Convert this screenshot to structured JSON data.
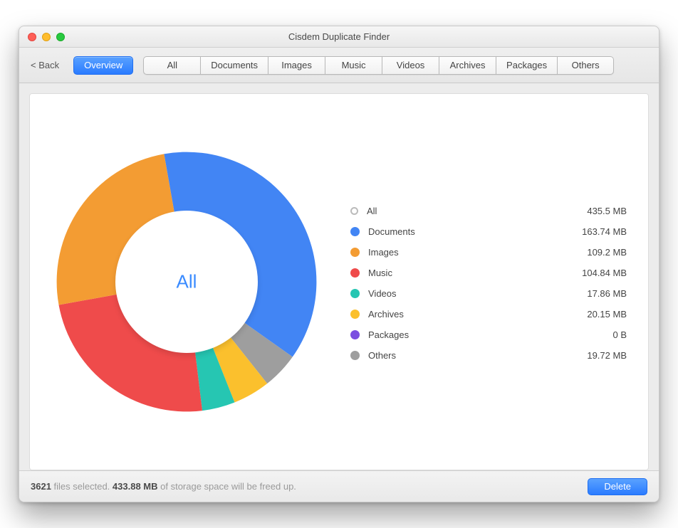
{
  "window": {
    "title": "Cisdem Duplicate Finder"
  },
  "toolbar": {
    "back_label": "< Back",
    "overview_label": "Overview",
    "tabs": [
      {
        "label": "All"
      },
      {
        "label": "Documents"
      },
      {
        "label": "Images"
      },
      {
        "label": "Music"
      },
      {
        "label": "Videos"
      },
      {
        "label": "Archives"
      },
      {
        "label": "Packages"
      },
      {
        "label": "Others"
      }
    ]
  },
  "chart_data": {
    "type": "pie",
    "title": "All",
    "series": [
      {
        "name": "Documents",
        "value_mb": 163.74,
        "color": "#4285f4"
      },
      {
        "name": "Others",
        "value_mb": 19.72,
        "color": "#9e9e9e"
      },
      {
        "name": "Archives",
        "value_mb": 20.15,
        "color": "#fbc02d"
      },
      {
        "name": "Videos",
        "value_mb": 17.86,
        "color": "#26c6b2"
      },
      {
        "name": "Music",
        "value_mb": 104.84,
        "color": "#ef4b4b"
      },
      {
        "name": "Images",
        "value_mb": 109.2,
        "color": "#f39c33"
      },
      {
        "name": "Packages",
        "value_mb": 0,
        "color": "#7b4fe0"
      }
    ],
    "total_label": "All",
    "total_display": "435.5 MB"
  },
  "legend": {
    "items": [
      {
        "label": "All",
        "value": "435.5 MB",
        "color": "hollow"
      },
      {
        "label": "Documents",
        "value": "163.74 MB",
        "color": "#4285f4"
      },
      {
        "label": "Images",
        "value": "109.2 MB",
        "color": "#f39c33"
      },
      {
        "label": "Music",
        "value": "104.84 MB",
        "color": "#ef4b4b"
      },
      {
        "label": "Videos",
        "value": "17.86 MB",
        "color": "#26c6b2"
      },
      {
        "label": "Archives",
        "value": "20.15 MB",
        "color": "#fbc02d"
      },
      {
        "label": "Packages",
        "value": "0 B",
        "color": "#7b4fe0"
      },
      {
        "label": "Others",
        "value": "19.72 MB",
        "color": "#9e9e9e"
      }
    ]
  },
  "footer": {
    "count": "3621",
    "count_suffix": " files selected. ",
    "size": "433.88 MB",
    "size_suffix": " of storage space will be freed up.",
    "delete_label": "Delete"
  }
}
